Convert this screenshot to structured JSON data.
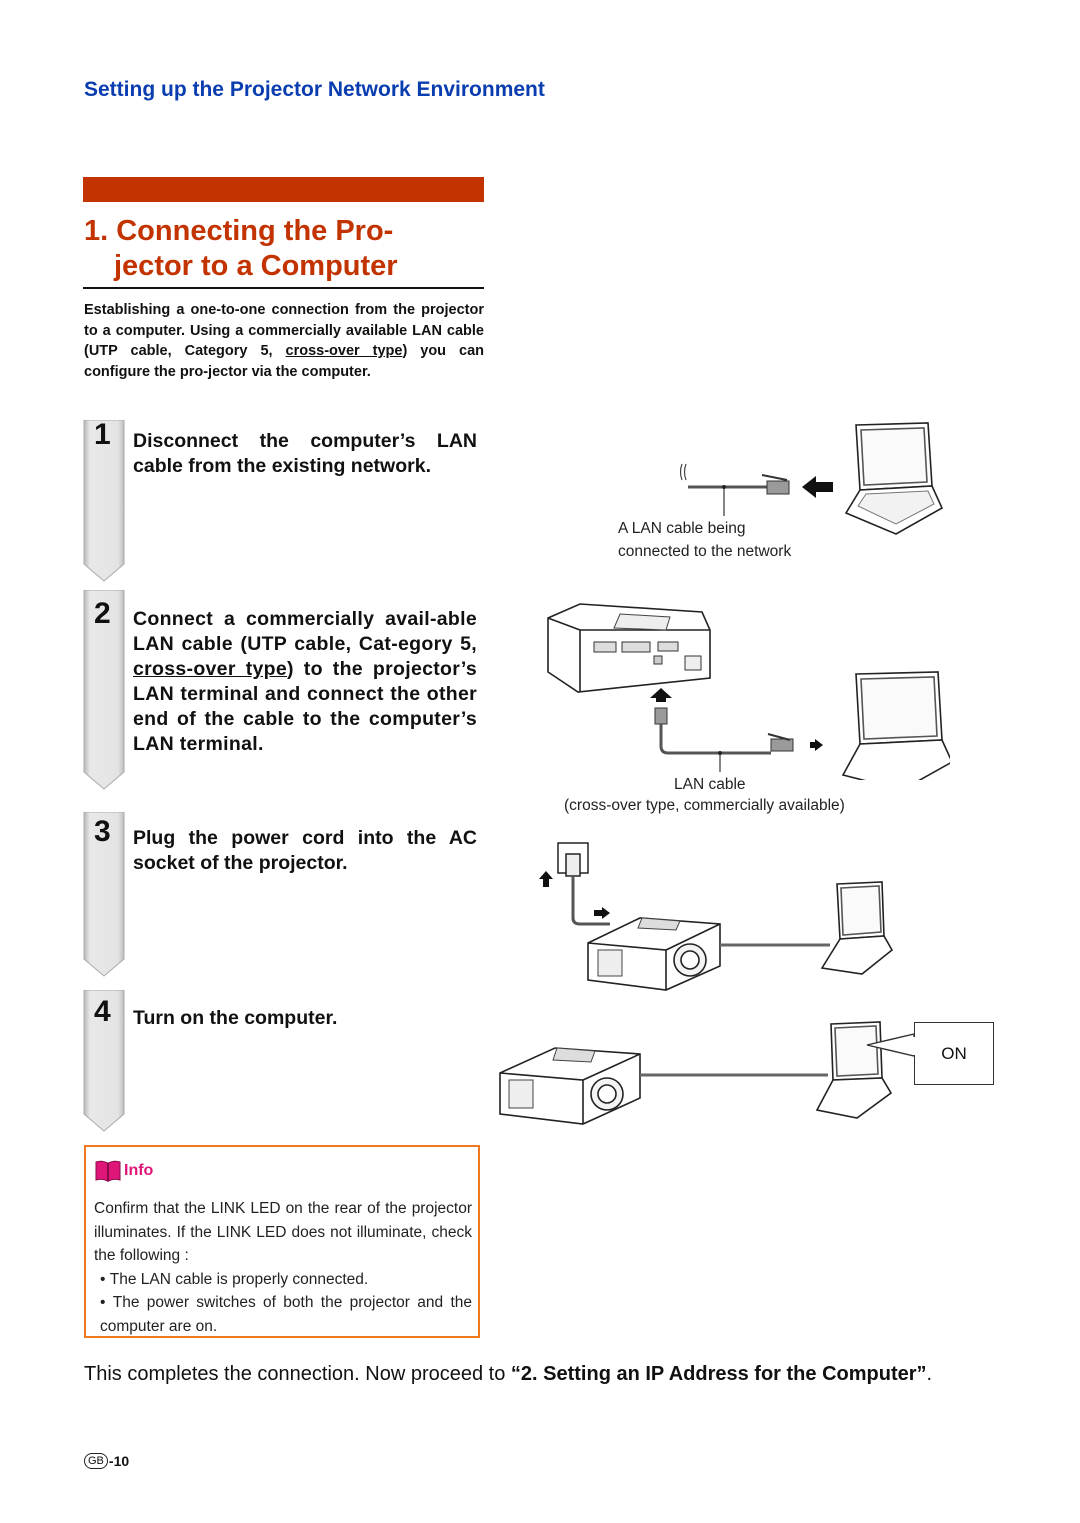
{
  "header": {
    "section_title": "Setting up the Projector Network Environment"
  },
  "chapter": {
    "title_line1": "1. Connecting the Pro-",
    "title_line2": "jector to a Computer",
    "accent_color": "#c23300"
  },
  "intro": {
    "part1": "Establishing a one-to-one connection from the projector to a computer. Using a commercially available LAN cable (UTP cable, Category 5, ",
    "underlined": "cross-over type",
    "part2": ") you can configure the pro-jector via the computer."
  },
  "steps": [
    {
      "number": "1",
      "text": "Disconnect the computer’s LAN cable from the existing network."
    },
    {
      "number": "2",
      "text_a": "Connect a commercially avail-able LAN cable (UTP cable, Cat-egory 5, ",
      "underlined": "cross-over type",
      "text_b": ") to the projector’s LAN terminal and connect the other end of the cable to the computer’s LAN terminal."
    },
    {
      "number": "3",
      "text": "Plug the power cord into the AC socket of the projector."
    },
    {
      "number": "4",
      "text": "Turn on the computer."
    }
  ],
  "info": {
    "label": "Info",
    "icon": "book-icon",
    "label_color": "#e0157a",
    "border_color": "#f07820",
    "body": "Confirm that the LINK LED on the rear of the projector illuminates. If the LINK LED does not illuminate, check the following :",
    "bullets": [
      "The LAN cable is properly connected.",
      "The power switches of both the projector and the computer are on."
    ]
  },
  "figures": {
    "fig1_caption_line1": "A LAN cable being",
    "fig1_caption_line2": "connected to the network",
    "fig2_caption_line1": "LAN cable",
    "fig2_caption_line2": "(cross-over type, commercially available)",
    "fig4_callout": "ON"
  },
  "closing": {
    "plain": "This completes the connection. Now proceed to ",
    "bold": "“2. Setting an IP Address for the Computer”",
    "end": "."
  },
  "footer": {
    "region_badge": "GB",
    "page_number": "-10"
  }
}
